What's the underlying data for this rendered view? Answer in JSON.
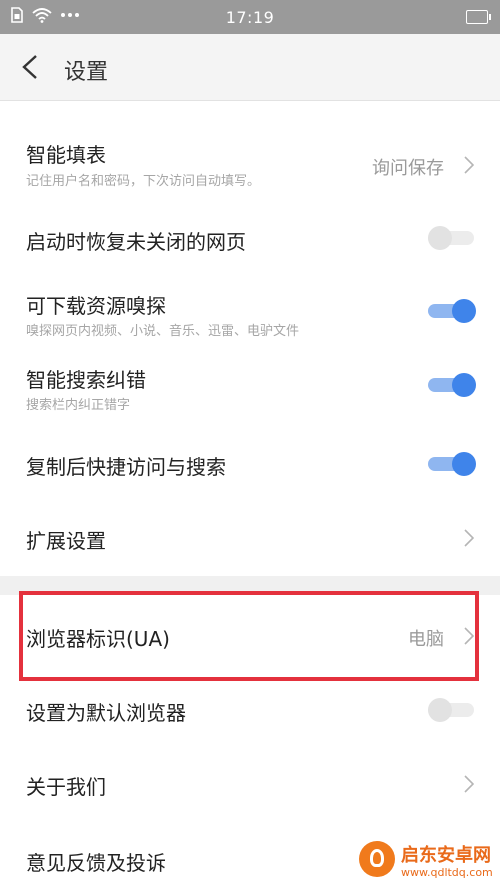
{
  "status_bar": {
    "time": "17:19",
    "icons": [
      "sim-icon",
      "wifi-icon",
      "more-dots-icon",
      "battery-icon"
    ]
  },
  "header": {
    "title": "设置",
    "back_icon": "chevron-left-icon"
  },
  "settings": [
    {
      "id": "autofill",
      "title": "智能填表",
      "subtitle": "记住用户名和密码，下次访问自动填写。",
      "value": "询问保存",
      "control": "chevron"
    },
    {
      "id": "restore-tabs",
      "title": "启动时恢复未关闭的网页",
      "control": "toggle",
      "enabled": false
    },
    {
      "id": "resource-sniff",
      "title": "可下载资源嗅探",
      "subtitle": "嗅探网页内视频、小说、音乐、迅雷、电驴文件",
      "control": "toggle",
      "enabled": true
    },
    {
      "id": "search-correct",
      "title": "智能搜索纠错",
      "subtitle": "搜索栏内纠正错字",
      "control": "toggle",
      "enabled": true
    },
    {
      "id": "quick-access",
      "title": "复制后快捷访问与搜索",
      "control": "toggle",
      "enabled": true
    },
    {
      "id": "extensions",
      "title": "扩展设置",
      "control": "chevron"
    },
    {
      "id": "user-agent",
      "title": "浏览器标识(UA)",
      "value": "电脑",
      "control": "chevron",
      "highlighted": true
    },
    {
      "id": "default-browser",
      "title": "设置为默认浏览器",
      "control": "toggle",
      "enabled": false
    },
    {
      "id": "about",
      "title": "关于我们",
      "control": "chevron"
    },
    {
      "id": "feedback",
      "title": "意见反馈及投诉",
      "control": "none"
    }
  ],
  "watermark": {
    "name": "启东安卓网",
    "url": "www.qdltdq.com"
  },
  "colors": {
    "accent": "#3f84ea",
    "highlight": "#e4313d",
    "status_bar": "#9a9a9a"
  }
}
